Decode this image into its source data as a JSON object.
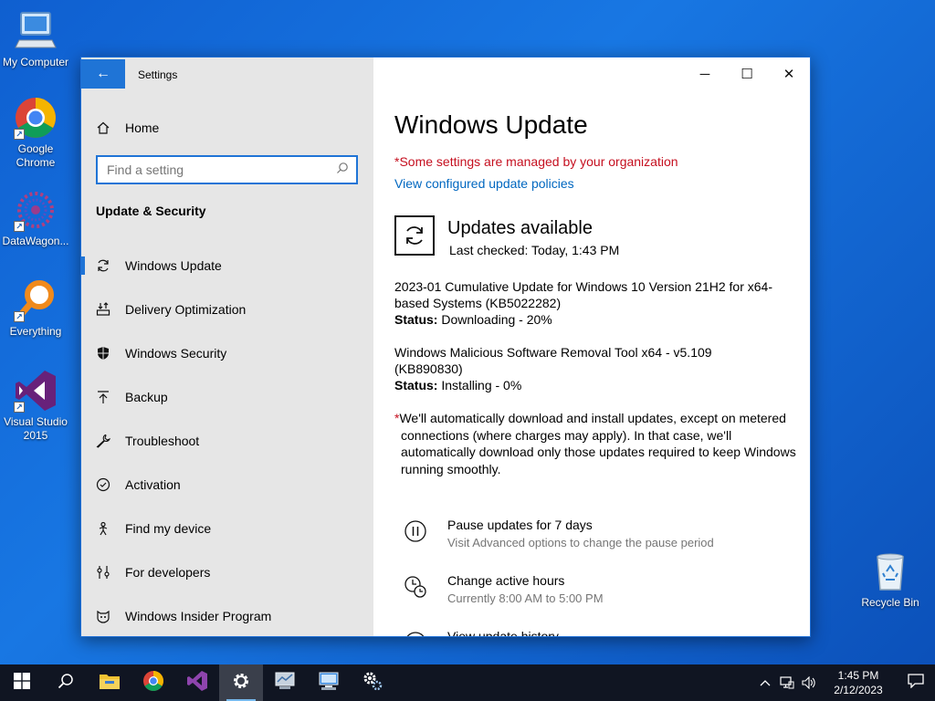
{
  "desktop": {
    "icons": [
      {
        "label": "My Computer",
        "icon": "computer-icon"
      },
      {
        "label": "Google Chrome",
        "icon": "chrome-icon"
      },
      {
        "label": "DataWagon...",
        "icon": "datawagon-icon"
      },
      {
        "label": "Everything",
        "icon": "everything-search-icon"
      },
      {
        "label": "Visual Studio 2015",
        "icon": "visual-studio-icon"
      },
      {
        "label": "Recycle Bin",
        "icon": "recycle-bin-icon"
      }
    ]
  },
  "window": {
    "title": "Settings",
    "controls": {
      "minimize": "─",
      "maximize": "☐",
      "close": "✕"
    }
  },
  "sidebar": {
    "home_label": "Home",
    "search_placeholder": "Find a setting",
    "section_title": "Update & Security",
    "items": [
      {
        "label": "Windows Update",
        "icon": "sync-icon",
        "active": true
      },
      {
        "label": "Delivery Optimization",
        "icon": "delivery-optimization-icon"
      },
      {
        "label": "Windows Security",
        "icon": "shield-icon"
      },
      {
        "label": "Backup",
        "icon": "backup-icon"
      },
      {
        "label": "Troubleshoot",
        "icon": "wrench-icon"
      },
      {
        "label": "Activation",
        "icon": "check-circle-icon"
      },
      {
        "label": "Find my device",
        "icon": "find-device-icon"
      },
      {
        "label": "For developers",
        "icon": "developer-icon"
      },
      {
        "label": "Windows Insider Program",
        "icon": "insider-icon"
      }
    ]
  },
  "main": {
    "title": "Windows Update",
    "managed_notice": "*Some settings are managed by your organization",
    "policies_link": "View configured update policies",
    "status_title": "Updates available",
    "last_checked": "Last checked: Today, 1:43 PM",
    "updates": [
      {
        "name": "2023-01 Cumulative Update for Windows 10 Version 21H2 for x64-based Systems (KB5022282)",
        "status_label": "Status:",
        "status_value": "Downloading - 20%"
      },
      {
        "name": "Windows Malicious Software Removal Tool x64 - v5.109 (KB890830)",
        "status_label": "Status:",
        "status_value": "Installing - 0%"
      }
    ],
    "note_star": "*",
    "note": "We'll automatically download and install updates, except on metered connections (where charges may apply). In that case, we'll automatically download only those updates required to keep Windows running smoothly.",
    "options": [
      {
        "title": "Pause updates for 7 days",
        "subtitle": "Visit Advanced options to change the pause period",
        "icon": "pause-icon"
      },
      {
        "title": "Change active hours",
        "subtitle": "Currently 8:00 AM to 5:00 PM",
        "icon": "clock-icon"
      },
      {
        "title": "View update history",
        "subtitle": "",
        "icon": "history-icon"
      }
    ]
  },
  "taskbar": {
    "apps": [
      "start-icon",
      "search-icon",
      "file-explorer-icon",
      "chrome-icon",
      "visual-studio-icon",
      "settings-gear-icon",
      "monitor-app-icon",
      "remote-desktop-icon",
      "gears-app-icon"
    ],
    "time": "1:45 PM",
    "date": "2/12/2023"
  },
  "colors": {
    "accent": "#1f74d6",
    "managed_red": "#c50f1f",
    "link_blue": "#0067c0",
    "sidebar_bg": "#e6e6e6",
    "taskbar_bg": "#101522"
  }
}
